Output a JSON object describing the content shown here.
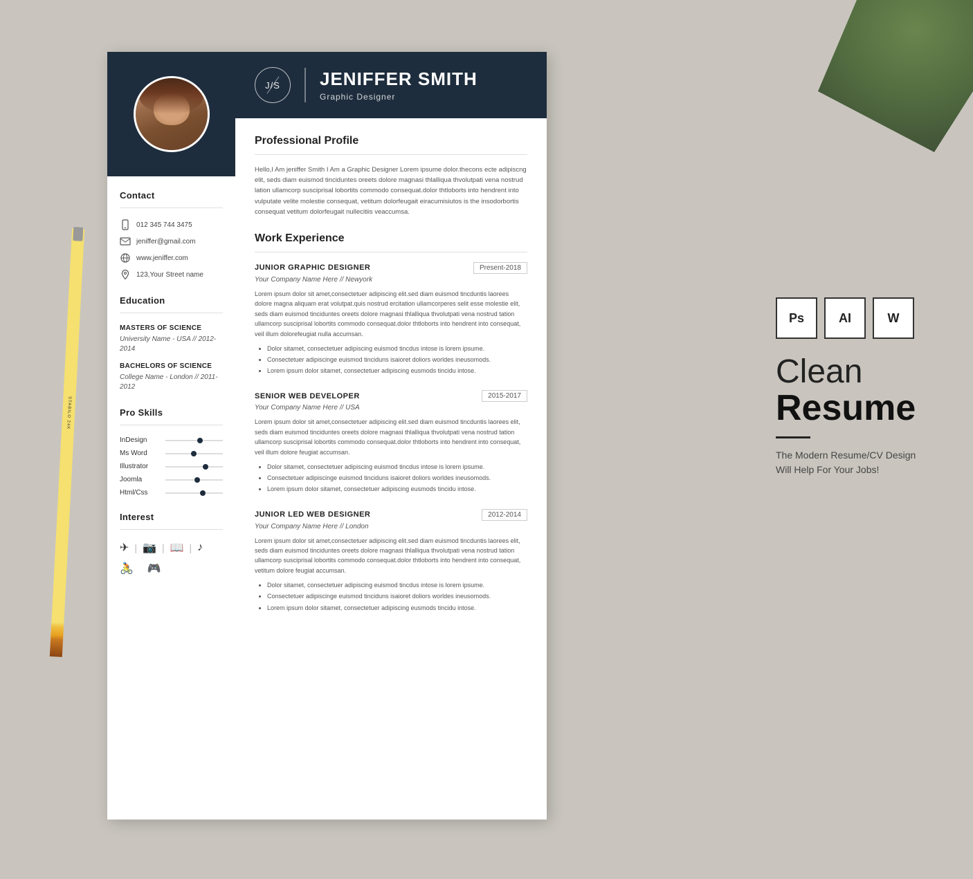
{
  "background": {
    "color": "#c9c5be"
  },
  "resume": {
    "sidebar": {
      "contact_title": "Contact",
      "phone": "012 345 744 3475",
      "email": "jeniffer@gmail.com",
      "website": "www.jeniffer.com",
      "address": "123,Your Street name",
      "education_title": "Education",
      "degrees": [
        {
          "degree": "MASTERS OF SCIENCE",
          "school": "University Name - USA // 2012-2014"
        },
        {
          "degree": "BACHELORS OF SCIENCE",
          "school": "College Name - London // 2011-2012"
        }
      ],
      "skills_title": "Pro Skills",
      "skills": [
        {
          "name": "InDesign",
          "level": 55
        },
        {
          "name": "Ms Word",
          "level": 45
        },
        {
          "name": "Illustrator",
          "level": 65
        },
        {
          "name": "Joomla",
          "level": 50
        },
        {
          "name": "Html/Css",
          "level": 60
        }
      ],
      "interests_title": "Interest"
    },
    "header": {
      "monogram": "J/S",
      "name": "JENIFFER SMITH",
      "title": "Graphic Designer"
    },
    "profile_section": "Professional Profile",
    "profile_text": "Hello,I Am jeniffer Smith I Am a Graphic Designer Lorem ipsume dolor.thecons ecte adipiscng elit, seds diam euismod tinciduntes oreets dolore magnasi thlalliqua thvolutpati vena nostrud lation ullamcorp susciprisal lobortits  commodo consequat.dolor thtloborts into hendrent into vulputate velite molestie consequat, vetitum dolorfeugait eiracumisiutos is the insodorbortis consequat vetitum dolorfeugait nullecitiis veaccumsa.",
    "work_section": "Work Experience",
    "work_entries": [
      {
        "title": "JUNIOR GRAPHIC DESIGNER",
        "date": "Present-2018",
        "company": "Your Company Name Here // Newyork",
        "description": "Lorem ipsum dolor sit amet,consectetuer adipiscing elit.sed diam euismod tincduntis laorees dolore magna aliquam erat volutpat.quis nostrud ercitation ullamcorperes selit esse molestie elit, seds diam euismod tinciduntes oreets dolore magnasi thlalliqua thvolutpati vena nostrud tation ullamcorp susciprisal lobortits  commodo consequat.dolor thtloborts into hendrent into  consequat, veil illum dolorefeugiat nulla accumsan.",
        "bullets": [
          "Dolor sitamet, consectetuer adipiscing euismod tincdus intose is lorem ipsume.",
          "Consectetuer adipiscinge euismod tinciduns  isaioret doliors worldes ineusomods.",
          "Lorem ipsum dolor sitamet, consectetuer adipiscing eusmods tincidu intose."
        ]
      },
      {
        "title": "SENIOR WEB DEVELOPER",
        "date": "2015-2017",
        "company": "Your Company Name Here // USA",
        "description": "Lorem ipsum dolor sit amet,consectetuer adipiscing elit.sed diam euismod tincduntis laorees elit, seds diam euismod tinciduntes oreets dolore magnasi thlalliqua thvolutpati vena nostrud tation ullamcorp susciprisal lobortits  commodo consequat.dolor thtloborts into hendrent into  consequat, veil illum dolore feugiat accumsan.",
        "bullets": [
          "Dolor sitamet, consectetuer adipiscing euismod tincdus intose is lorem ipsume.",
          "Consectetuer adipiscinge euismod tinciduns  isaioret doliors worldes ineusomods.",
          "Lorem ipsum dolor sitamet, consectetuer adipiscing eusmods tincidu intose."
        ]
      },
      {
        "title": "JUNIOR LED WEB DESIGNER",
        "date": "2012-2014",
        "company": "Your Company Name Here // London",
        "description": "Lorem ipsum dolor sit amet,consectetuer adipiscing elit.sed diam euismod tincduntis laorees elit, seds diam euismod tinciduntes oreets dolore magnasi thlalliqua thvolutpati vena nostrud tation ullamcorp susciprisal lobortits  commodo consequat.dolor thtloborts into hendrent into  consequat, vetitum dolore feugiat accumsan.",
        "bullets": [
          "Dolor sitamet, consectetuer adipiscing euismod tincdus intose is lorem ipsume.",
          "Consectetuer adipiscinge euismod tinciduns  isaioret doliors worldes ineusomods.",
          "Lorem ipsum dolor sitamet, consectetuer adipiscing eusmods tincidu intose."
        ]
      }
    ]
  },
  "promo": {
    "tools": [
      "Ps",
      "AI",
      "W"
    ],
    "headline1": "Clean",
    "headline2": "Resume",
    "tagline": "The Modern Resume/CV Design Will Help For Your Jobs!"
  }
}
